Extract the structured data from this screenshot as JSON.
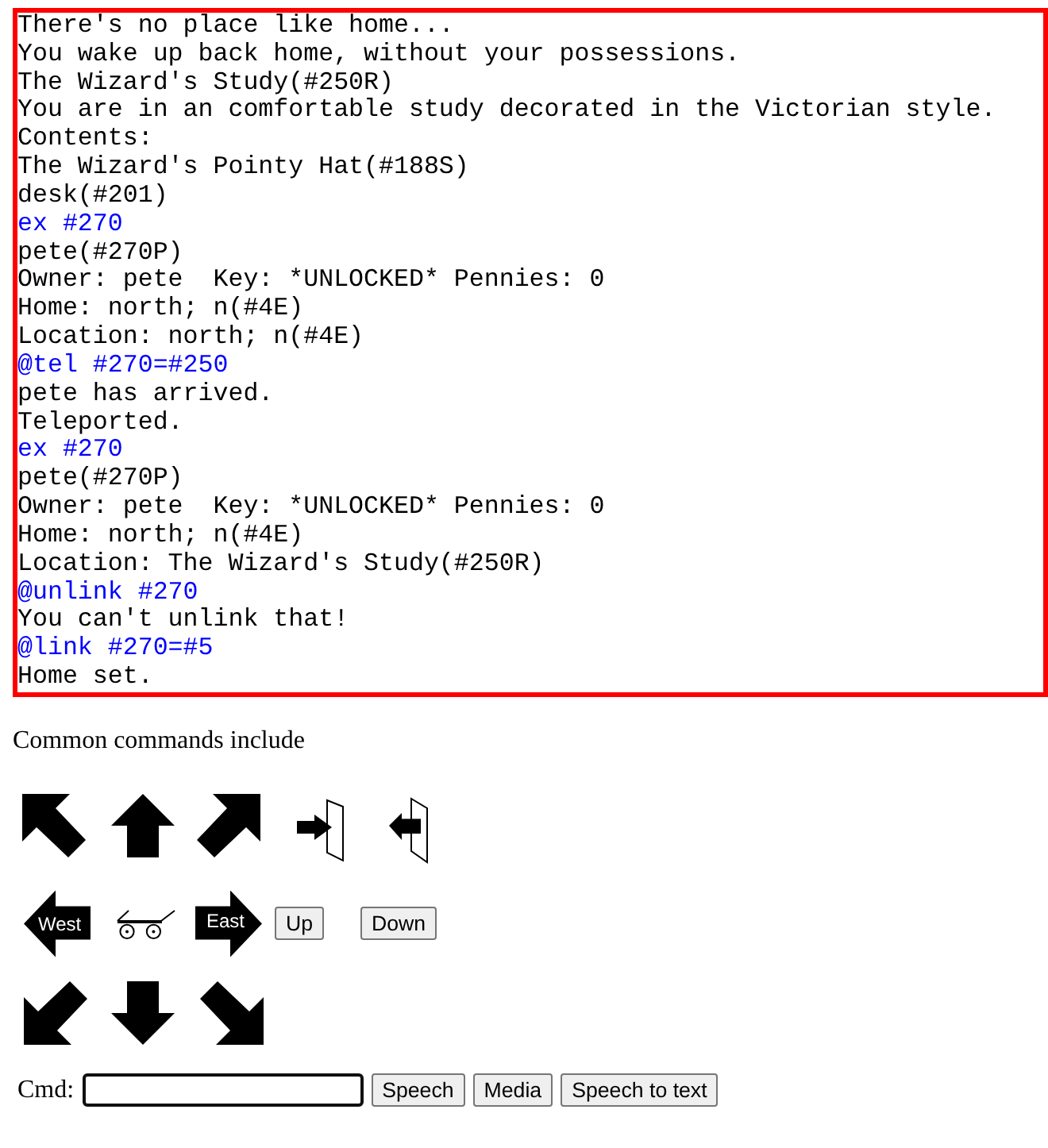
{
  "log": {
    "lines": [
      {
        "kind": "output",
        "text": "There's no place like home..."
      },
      {
        "kind": "output",
        "text": "You wake up back home, without your possessions."
      },
      {
        "kind": "output",
        "text": "The Wizard's Study(#250R)"
      },
      {
        "kind": "output",
        "text": "You are in an comfortable study decorated in the Victorian style."
      },
      {
        "kind": "output",
        "text": "Contents:"
      },
      {
        "kind": "output",
        "text": "The Wizard's Pointy Hat(#188S)"
      },
      {
        "kind": "output",
        "text": "desk(#201)"
      },
      {
        "kind": "command",
        "text": "ex #270"
      },
      {
        "kind": "output",
        "text": "pete(#270P)"
      },
      {
        "kind": "output",
        "text": "Owner: pete  Key: *UNLOCKED* Pennies: 0"
      },
      {
        "kind": "output",
        "text": "Home: north; n(#4E)"
      },
      {
        "kind": "output",
        "text": "Location: north; n(#4E)"
      },
      {
        "kind": "command",
        "text": "@tel #270=#250"
      },
      {
        "kind": "output",
        "text": "pete has arrived."
      },
      {
        "kind": "output",
        "text": "Teleported."
      },
      {
        "kind": "command",
        "text": "ex #270"
      },
      {
        "kind": "output",
        "text": "pete(#270P)"
      },
      {
        "kind": "output",
        "text": "Owner: pete  Key: *UNLOCKED* Pennies: 0"
      },
      {
        "kind": "output",
        "text": "Home: north; n(#4E)"
      },
      {
        "kind": "output",
        "text": "Location: The Wizard's Study(#250R)"
      },
      {
        "kind": "command",
        "text": "@unlink #270"
      },
      {
        "kind": "output",
        "text": "You can't unlink that!"
      },
      {
        "kind": "command",
        "text": "@link #270=#5"
      },
      {
        "kind": "output",
        "text": "Home set."
      }
    ]
  },
  "intro": "Common commands include",
  "navigation": {
    "west": "West",
    "east": "East",
    "up": "Up",
    "down": "Down"
  },
  "command_bar": {
    "label": "Cmd:",
    "buttons": [
      "Speech",
      "Media",
      "Speech to text"
    ]
  }
}
